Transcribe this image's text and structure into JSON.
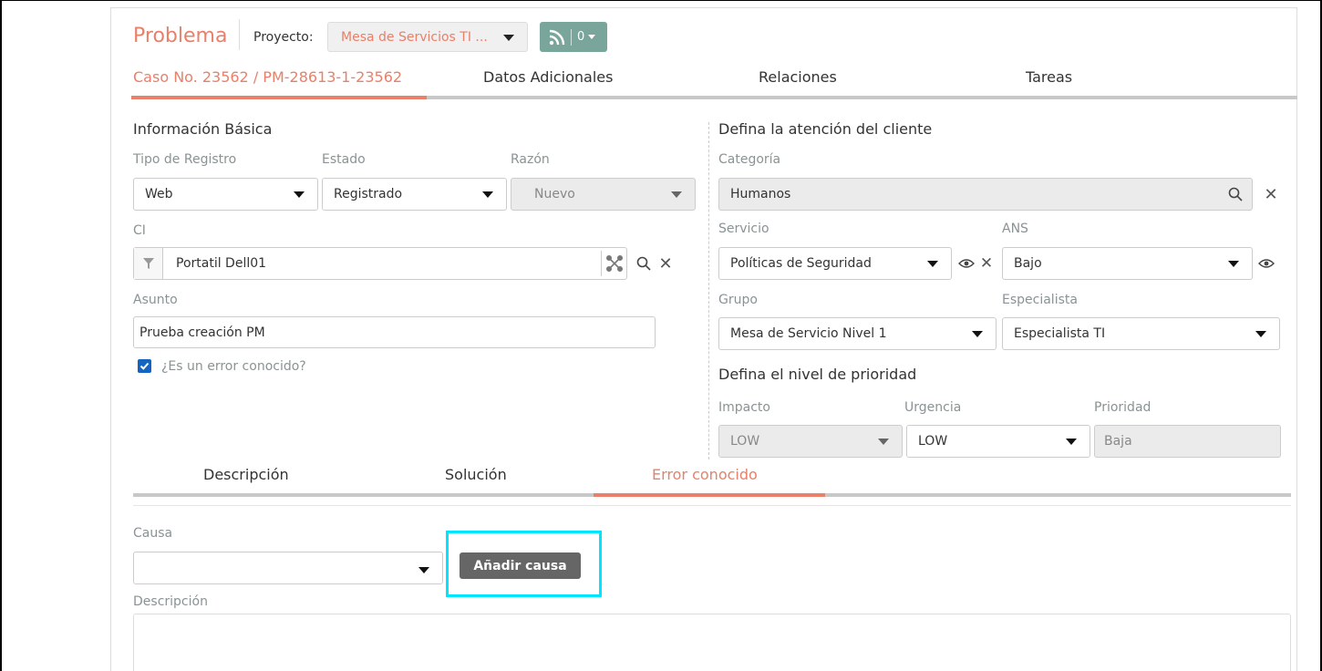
{
  "header": {
    "title": "Problema",
    "project_label": "Proyecto:",
    "project_value": "Mesa de Servicios TI ...",
    "feed_count": "0"
  },
  "tabs": [
    {
      "label": "Caso No. 23562 / PM-28613-1-23562",
      "active": true
    },
    {
      "label": "Datos Adicionales",
      "active": false
    },
    {
      "label": "Relaciones",
      "active": false
    },
    {
      "label": "Tareas",
      "active": false
    }
  ],
  "basic_info": {
    "section_title": "Información Básica",
    "tipo_registro": {
      "label": "Tipo de Registro",
      "value": "Web"
    },
    "estado": {
      "label": "Estado",
      "value": "Registrado"
    },
    "razon": {
      "label": "Razón",
      "value": "Nuevo"
    },
    "ci": {
      "label": "CI",
      "value": "Portatil Dell01"
    },
    "asunto": {
      "label": "Asunto",
      "value": "Prueba creación PM"
    },
    "known_error": {
      "label": "¿Es un error conocido?",
      "checked": true
    }
  },
  "client_attention": {
    "section_title": "Defina la atención del cliente",
    "categoria": {
      "label": "Categoría",
      "value": "Humanos"
    },
    "servicio": {
      "label": "Servicio",
      "value": "Políticas de Seguridad"
    },
    "ans": {
      "label": "ANS",
      "value": "Bajo"
    },
    "grupo": {
      "label": "Grupo",
      "value": "Mesa de Servicio Nivel 1"
    },
    "especialista": {
      "label": "Especialista",
      "value": "Especialista TI"
    }
  },
  "priority": {
    "section_title": "Defina el nivel de prioridad",
    "impacto": {
      "label": "Impacto",
      "value": "LOW"
    },
    "urgencia": {
      "label": "Urgencia",
      "value": "LOW"
    },
    "prioridad": {
      "label": "Prioridad",
      "value": "Baja"
    }
  },
  "bottom_tabs": [
    {
      "label": "Descripción",
      "active": false
    },
    {
      "label": "Solución",
      "active": false
    },
    {
      "label": "Error conocido",
      "active": true
    }
  ],
  "known_error_panel": {
    "causa_label": "Causa",
    "causa_value": "",
    "add_cause_button": "Añadir causa",
    "descripcion_label": "Descripción",
    "descripcion_value": ""
  },
  "colors": {
    "accent": "#e8806a",
    "highlight": "#00e5ff",
    "button_dark": "#666666",
    "rss_button": "#7aa59a"
  }
}
